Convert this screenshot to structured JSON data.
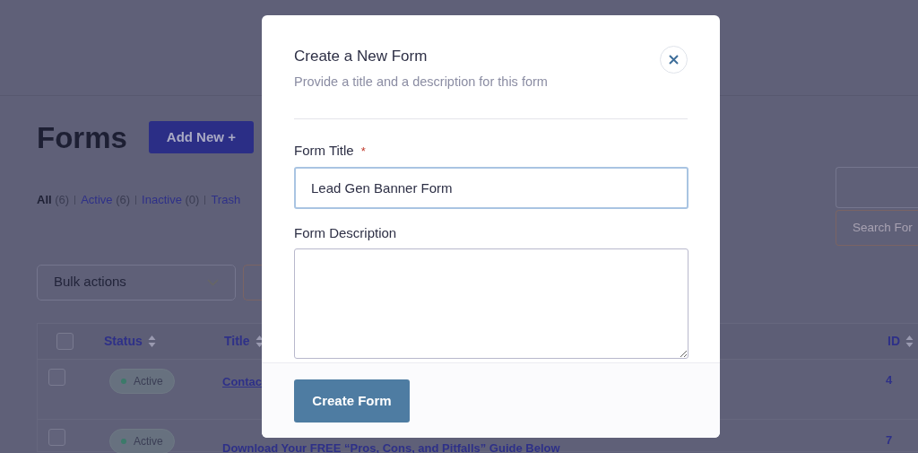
{
  "page": {
    "title": "Forms",
    "add_button": "Add New +",
    "filters": [
      {
        "label": "All",
        "count": "(6)",
        "selected": true
      },
      {
        "label": "Active",
        "count": "(6)",
        "selected": false
      },
      {
        "label": "Inactive",
        "count": "(0)",
        "selected": false
      },
      {
        "label": "Trash",
        "selected": false
      }
    ],
    "search": {
      "button": "Search For"
    },
    "bulk_actions": {
      "value": "Bulk actions"
    },
    "table": {
      "all_checked": false,
      "columns": [
        {
          "label": "Status"
        },
        {
          "label": "Title"
        },
        {
          "label": "ID"
        }
      ],
      "rows": [
        {
          "checked": false,
          "status": "Active",
          "title": "Contac",
          "id": "4"
        },
        {
          "checked": false,
          "status": "Active",
          "title": "Download Your FREE “Pros, Cons, and Pitfalls” Guide Below",
          "id": "7"
        }
      ]
    }
  },
  "modal": {
    "title": "Create a New Form",
    "subtitle": "Provide a title and a description for this form",
    "fields": [
      {
        "kind": "input",
        "label": "Form Title",
        "required_mark": "*",
        "value": "Lead Gen Banner Form",
        "focused": true
      },
      {
        "kind": "textarea",
        "label": "Form Description",
        "focused": false
      }
    ],
    "submit": "Create Form"
  }
}
